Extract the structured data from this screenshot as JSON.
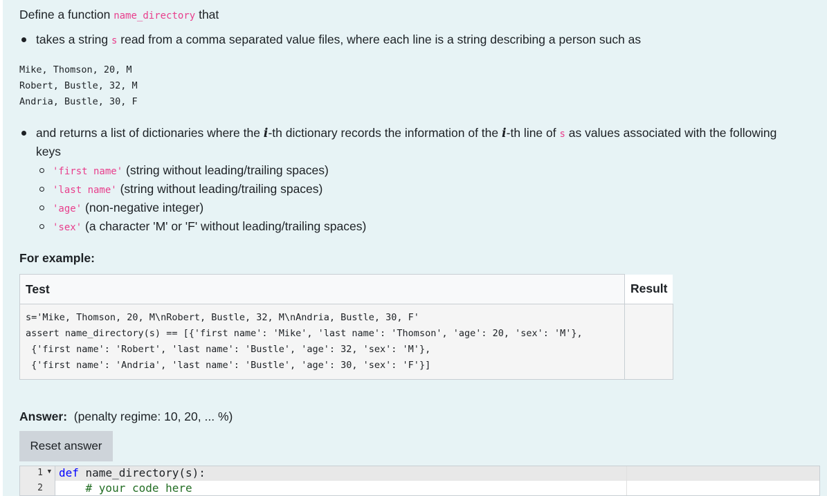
{
  "intro": {
    "prefix": "Define a function ",
    "func_name": "name_directory",
    "suffix": " that"
  },
  "bullet1": {
    "prefix": "takes a string ",
    "var": "s",
    "suffix": " read from a comma separated value files, where each line is a string describing a person such as"
  },
  "sample_lines": [
    "Mike, Thomson, 20, M",
    "Robert, Bustle, 32, M",
    "Andria, Bustle, 30, F"
  ],
  "bullet2": {
    "part1": "and returns a list of dictionaries where the ",
    "math_i": "i",
    "part2": "-th dictionary records the information of the ",
    "part3": "-th line of ",
    "var": "s",
    "part4": " as values associated with the following",
    "part5": "keys"
  },
  "keys": [
    {
      "key": "'first name'",
      "desc": " (string without leading/trailing spaces)"
    },
    {
      "key": "'last name'",
      "desc": " (string without leading/trailing spaces)"
    },
    {
      "key": "'age'",
      "desc": " (non-negative integer)"
    },
    {
      "key": "'sex'",
      "desc": " (a character 'M' or 'F' without leading/trailing spaces)"
    }
  ],
  "for_example": "For example:",
  "table": {
    "header_test": "Test",
    "header_result": "Result",
    "test_lines": [
      "s='Mike, Thomson, 20, M\\nRobert, Bustle, 32, M\\nAndria, Bustle, 30, F'",
      "assert name_directory(s) == [{'first name': 'Mike', 'last name': 'Thomson', 'age': 20, 'sex': 'M'},",
      " {'first name': 'Robert', 'last name': 'Bustle', 'age': 32, 'sex': 'M'},",
      " {'first name': 'Andria', 'last name': 'Bustle', 'age': 30, 'sex': 'F'}]"
    ],
    "result": ""
  },
  "answer": {
    "label": "Answer:",
    "penalty": "(penalty regime: 10, 20, ... %)"
  },
  "reset_button": "Reset answer",
  "editor": {
    "line_numbers": [
      "1",
      "2"
    ],
    "fold_marker": "▼",
    "line1_kw": "def",
    "line1_rest": " name_directory(s):",
    "line2_comment": "    # your code here"
  }
}
